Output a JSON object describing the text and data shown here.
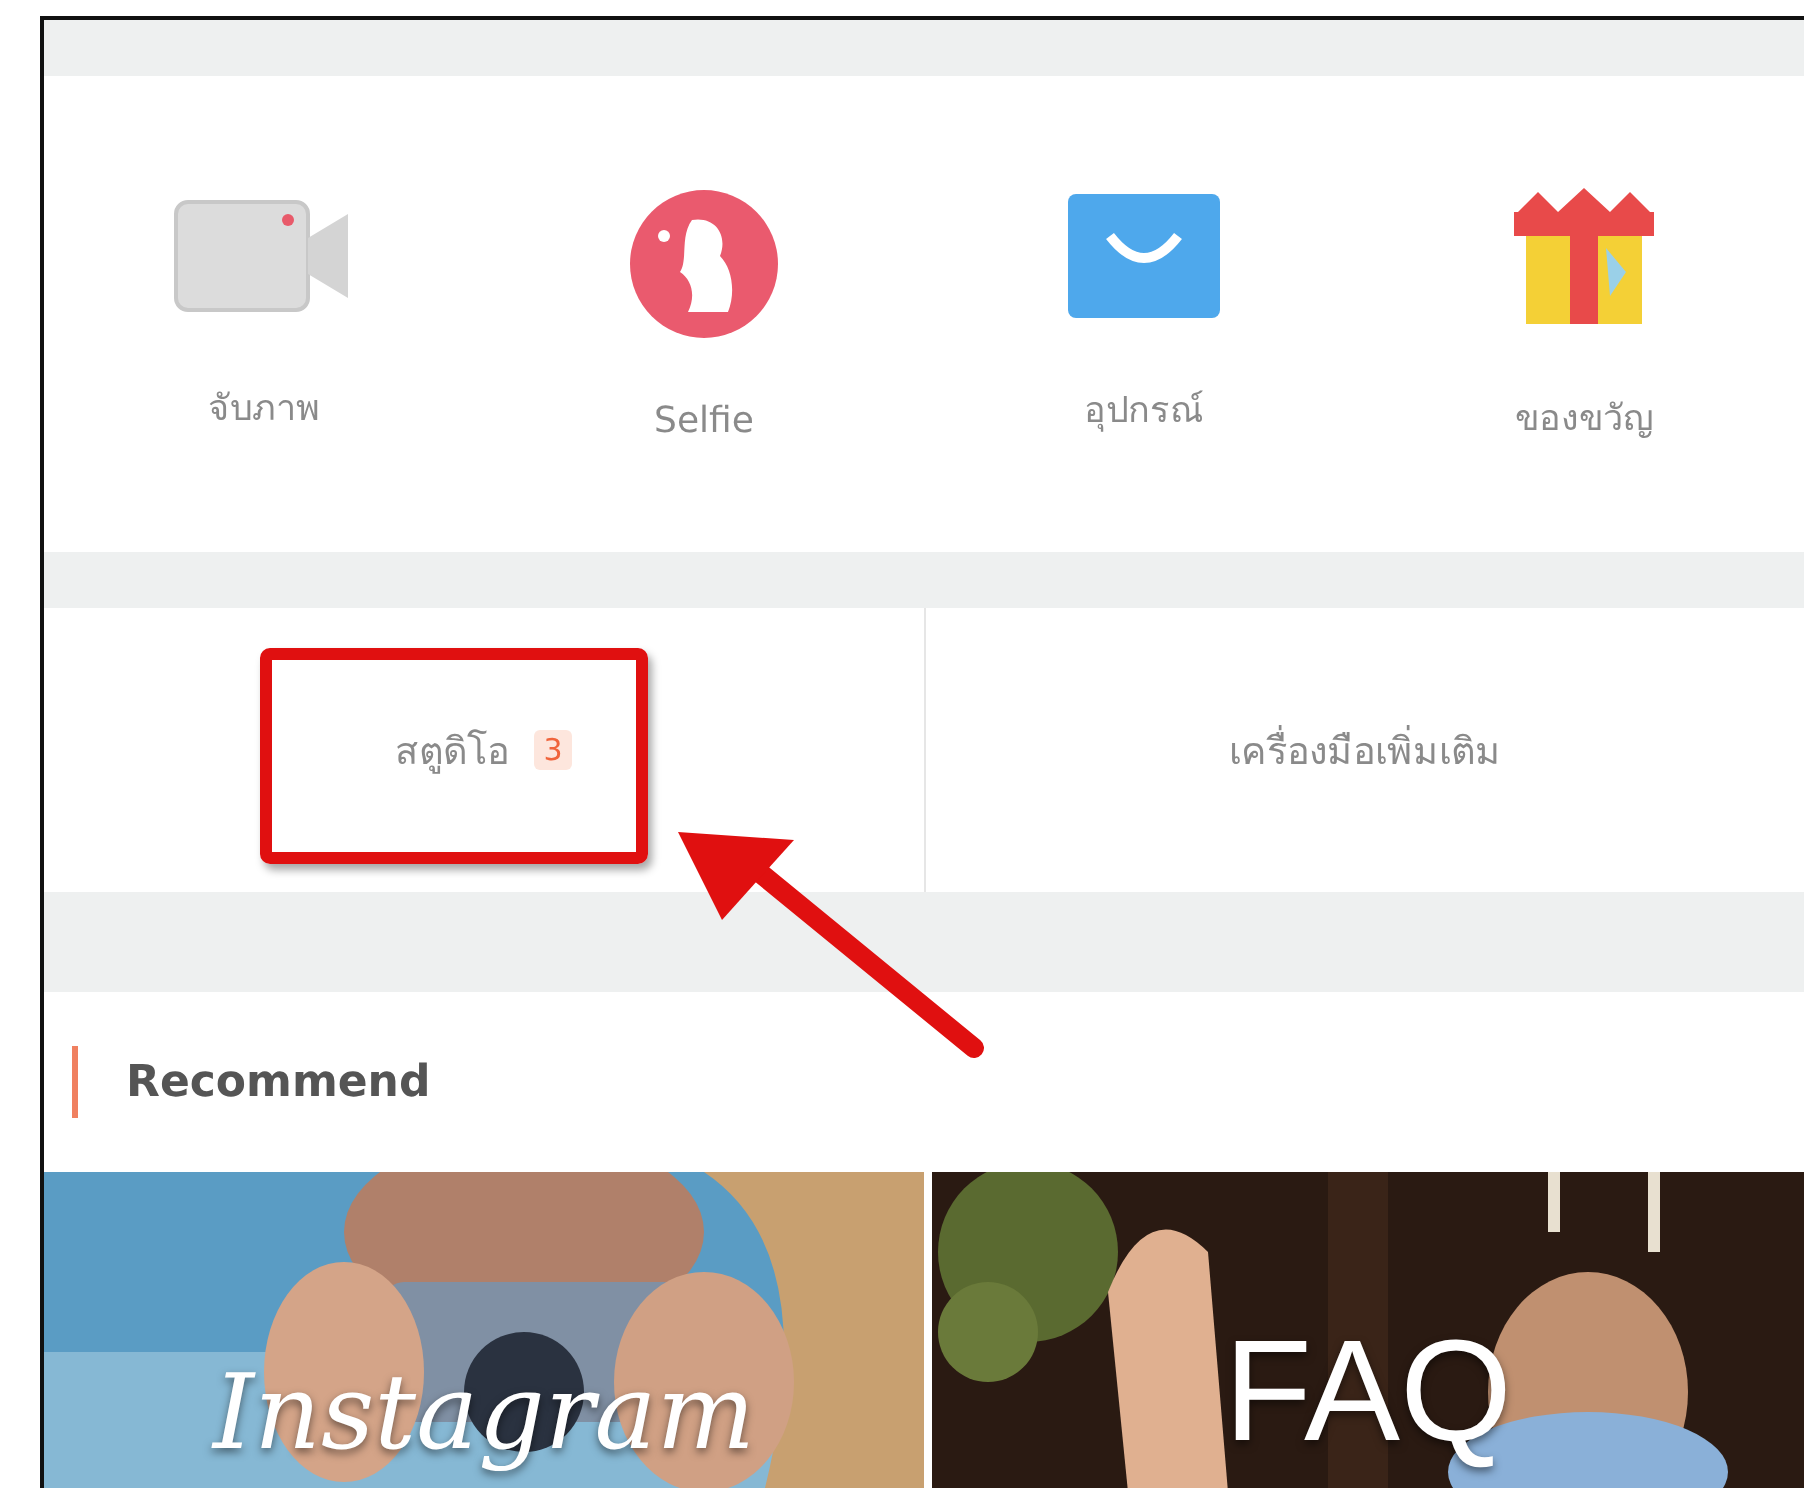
{
  "shortcuts": [
    {
      "label": "จับภาพ",
      "kind": "camera"
    },
    {
      "label": "Selfie",
      "kind": "selfie"
    },
    {
      "label": "อุปกรณ์",
      "kind": "bag"
    },
    {
      "label": "ของขวัญ",
      "kind": "gift"
    }
  ],
  "tabs": [
    {
      "label": "สตูดิโอ",
      "badge": "3",
      "highlighted": true
    },
    {
      "label": "เครื่องมือเพิ่มเติม",
      "highlighted": false
    }
  ],
  "section": {
    "title": "Recommend"
  },
  "cards": [
    {
      "title": "Instagram",
      "kind": "script"
    },
    {
      "title": "FAQ",
      "kind": "block"
    }
  ]
}
